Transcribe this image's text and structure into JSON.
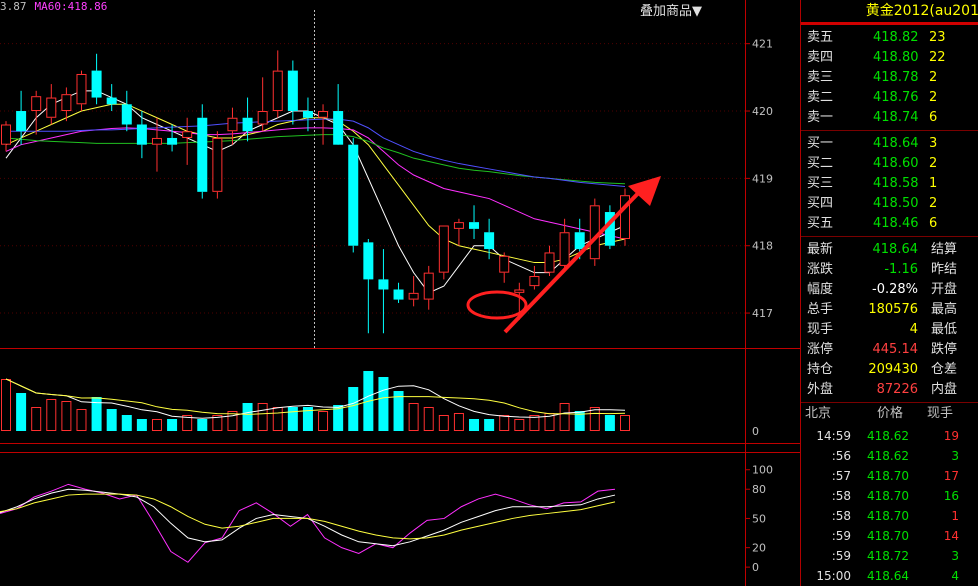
{
  "header": {
    "ma_prefix": "3.87",
    "ma60": "MA60:418.86",
    "overlay_button": "叠加商品▼"
  },
  "symbol": {
    "name": "黄金2012",
    "code": "(au201"
  },
  "colors": {
    "up": "#ff3030",
    "down": "#00ffff",
    "ma_white": "#ffffff",
    "ma_yellow": "#ffff40",
    "ma_magenta": "#ff30ff",
    "ma_green": "#20c020",
    "ma_blue": "#5050ff",
    "arrow": "#ff2020"
  },
  "order_book": {
    "asks": [
      {
        "label": "卖五",
        "price": "418.82",
        "volume": "23"
      },
      {
        "label": "卖四",
        "price": "418.80",
        "volume": "22"
      },
      {
        "label": "卖三",
        "price": "418.78",
        "volume": "2"
      },
      {
        "label": "卖二",
        "price": "418.76",
        "volume": "2"
      },
      {
        "label": "卖一",
        "price": "418.74",
        "volume": "6"
      }
    ],
    "bids": [
      {
        "label": "买一",
        "price": "418.64",
        "volume": "3"
      },
      {
        "label": "买二",
        "price": "418.60",
        "volume": "2"
      },
      {
        "label": "买三",
        "price": "418.58",
        "volume": "1"
      },
      {
        "label": "买四",
        "price": "418.50",
        "volume": "2"
      },
      {
        "label": "买五",
        "price": "418.46",
        "volume": "6"
      }
    ]
  },
  "quote": [
    {
      "label": "最新",
      "value": "418.64",
      "label2": "结算",
      "color": "#00e000"
    },
    {
      "label": "涨跌",
      "value": "-1.16",
      "label2": "昨结",
      "color": "#00e000"
    },
    {
      "label": "幅度",
      "value": "-0.28%",
      "label2": "开盘",
      "color": "#ffffff"
    },
    {
      "label": "总手",
      "value": "180576",
      "label2": "最高",
      "color": "#ffff00"
    },
    {
      "label": "现手",
      "value": "4",
      "label2": "最低",
      "color": "#ffff00"
    },
    {
      "label": "涨停",
      "value": "445.14",
      "label2": "跌停",
      "color": "#ff4040"
    },
    {
      "label": "持仓",
      "value": "209430",
      "label2": "仓差",
      "color": "#ffff00"
    },
    {
      "label": "外盘",
      "value": "87226",
      "label2": "内盘",
      "color": "#ff4040"
    }
  ],
  "ticks_header": {
    "place": "北京",
    "price": "价格",
    "qty": "现手"
  },
  "ticks": [
    {
      "time": "14:59",
      "price": "418.62",
      "qty": "19",
      "qcolor": "#ff3030"
    },
    {
      "time": ":56",
      "price": "418.62",
      "qty": "3",
      "qcolor": "#00e000"
    },
    {
      "time": ":57",
      "price": "418.70",
      "qty": "17",
      "qcolor": "#ff3030"
    },
    {
      "time": ":58",
      "price": "418.70",
      "qty": "16",
      "qcolor": "#00e000"
    },
    {
      "time": ":58",
      "price": "418.70",
      "qty": "1",
      "qcolor": "#ff3030"
    },
    {
      "time": ":59",
      "price": "418.70",
      "qty": "14",
      "qcolor": "#ff3030"
    },
    {
      "time": ":59",
      "price": "418.72",
      "qty": "3",
      "qcolor": "#00e000"
    },
    {
      "time": "15:00",
      "price": "418.64",
      "qty": "4",
      "qcolor": "#00e000"
    }
  ],
  "chart_data": {
    "type": "candlestick",
    "price_axis": {
      "ylim": [
        416.6,
        421.5
      ],
      "ticks": [
        "421",
        "420",
        "419",
        "418",
        "417"
      ]
    },
    "volume_axis": {
      "ticks": [
        "0"
      ]
    },
    "oscillator_axis": {
      "ylim": [
        -5,
        110
      ],
      "ticks": [
        "100",
        "80",
        "50",
        "20",
        "0"
      ]
    },
    "candles": [
      {
        "o": 419.5,
        "h": 419.85,
        "l": 419.4,
        "c": 419.8
      },
      {
        "o": 420.0,
        "h": 420.3,
        "l": 419.5,
        "c": 419.7
      },
      {
        "o": 420.0,
        "h": 420.3,
        "l": 419.65,
        "c": 420.22
      },
      {
        "o": 419.9,
        "h": 420.4,
        "l": 419.8,
        "c": 420.2
      },
      {
        "o": 420.0,
        "h": 420.35,
        "l": 419.85,
        "c": 420.25
      },
      {
        "o": 420.1,
        "h": 420.6,
        "l": 420.0,
        "c": 420.55
      },
      {
        "o": 420.6,
        "h": 420.85,
        "l": 420.1,
        "c": 420.2
      },
      {
        "o": 420.2,
        "h": 420.4,
        "l": 420.0,
        "c": 420.1
      },
      {
        "o": 420.1,
        "h": 420.3,
        "l": 419.7,
        "c": 419.8
      },
      {
        "o": 419.8,
        "h": 420.0,
        "l": 419.3,
        "c": 419.5
      },
      {
        "o": 419.5,
        "h": 419.9,
        "l": 419.1,
        "c": 419.6
      },
      {
        "o": 419.6,
        "h": 419.8,
        "l": 419.4,
        "c": 419.5
      },
      {
        "o": 419.6,
        "h": 419.9,
        "l": 419.2,
        "c": 419.7
      },
      {
        "o": 419.9,
        "h": 420.1,
        "l": 418.7,
        "c": 418.8
      },
      {
        "o": 418.8,
        "h": 419.7,
        "l": 418.7,
        "c": 419.6
      },
      {
        "o": 419.7,
        "h": 420.05,
        "l": 419.5,
        "c": 419.9
      },
      {
        "o": 419.9,
        "h": 420.2,
        "l": 419.55,
        "c": 419.7
      },
      {
        "o": 419.8,
        "h": 420.5,
        "l": 419.7,
        "c": 420.0
      },
      {
        "o": 420.0,
        "h": 420.9,
        "l": 419.9,
        "c": 420.6
      },
      {
        "o": 420.6,
        "h": 420.75,
        "l": 419.8,
        "c": 420.0
      },
      {
        "o": 420.0,
        "h": 420.2,
        "l": 419.7,
        "c": 419.9
      },
      {
        "o": 419.9,
        "h": 420.1,
        "l": 419.5,
        "c": 420.0
      },
      {
        "o": 420.0,
        "h": 420.4,
        "l": 419.7,
        "c": 419.5
      },
      {
        "o": 419.5,
        "h": 419.6,
        "l": 417.9,
        "c": 418.0
      },
      {
        "o": 418.05,
        "h": 418.1,
        "l": 416.7,
        "c": 417.5
      },
      {
        "o": 417.5,
        "h": 417.95,
        "l": 416.7,
        "c": 417.35
      },
      {
        "o": 417.35,
        "h": 417.45,
        "l": 417.15,
        "c": 417.2
      },
      {
        "o": 417.2,
        "h": 417.55,
        "l": 417.1,
        "c": 417.3
      },
      {
        "o": 417.2,
        "h": 417.7,
        "l": 417.05,
        "c": 417.6
      },
      {
        "o": 417.6,
        "h": 418.3,
        "l": 417.5,
        "c": 418.3
      },
      {
        "o": 418.25,
        "h": 418.4,
        "l": 418.0,
        "c": 418.35
      },
      {
        "o": 418.35,
        "h": 418.6,
        "l": 418.1,
        "c": 418.25
      },
      {
        "o": 418.2,
        "h": 418.4,
        "l": 417.8,
        "c": 417.95
      },
      {
        "o": 417.6,
        "h": 417.9,
        "l": 417.45,
        "c": 417.85
      },
      {
        "o": 417.3,
        "h": 417.45,
        "l": 416.9,
        "c": 417.35
      },
      {
        "o": 417.4,
        "h": 417.7,
        "l": 417.35,
        "c": 417.55
      },
      {
        "o": 417.6,
        "h": 418.0,
        "l": 417.55,
        "c": 417.9
      },
      {
        "o": 417.7,
        "h": 418.4,
        "l": 417.65,
        "c": 418.2
      },
      {
        "o": 418.2,
        "h": 418.4,
        "l": 417.8,
        "c": 417.95
      },
      {
        "o": 417.8,
        "h": 418.7,
        "l": 417.7,
        "c": 418.6
      },
      {
        "o": 418.5,
        "h": 418.6,
        "l": 417.95,
        "c": 418.0
      },
      {
        "o": 418.1,
        "h": 418.85,
        "l": 418.0,
        "c": 418.75
      }
    ],
    "ma_series": [
      {
        "color": "#ffffff",
        "values": [
          419.3,
          419.6,
          419.9,
          420.1,
          420.2,
          420.3,
          420.3,
          420.2,
          420.1,
          419.9,
          419.8,
          419.7,
          419.6,
          419.5,
          419.4,
          419.5,
          419.7,
          419.8,
          419.9,
          420.0,
          420.0,
          419.9,
          419.8,
          419.5,
          419.0,
          418.5,
          418.0,
          417.6,
          417.3,
          417.4,
          417.7,
          418.0,
          418.0,
          417.8,
          417.7,
          417.6,
          417.6,
          417.8,
          418.0,
          418.1,
          418.2,
          418.3
        ]
      },
      {
        "color": "#ffff40",
        "values": [
          419.5,
          419.6,
          419.7,
          419.8,
          419.9,
          420.0,
          420.05,
          420.1,
          420.1,
          420.0,
          419.9,
          419.8,
          419.7,
          419.65,
          419.6,
          419.6,
          419.65,
          419.7,
          419.8,
          419.85,
          419.9,
          419.9,
          419.85,
          419.7,
          419.5,
          419.2,
          418.9,
          418.6,
          418.3,
          418.1,
          418.0,
          417.95,
          417.9,
          417.85,
          417.8,
          417.75,
          417.75,
          417.8,
          417.9,
          418.0,
          418.05,
          418.1
        ]
      },
      {
        "color": "#ff30ff",
        "values": [
          419.4,
          419.5,
          419.55,
          419.6,
          419.65,
          419.7,
          419.72,
          419.74,
          419.75,
          419.74,
          419.72,
          419.7,
          419.68,
          419.65,
          419.65,
          419.66,
          419.68,
          419.7,
          419.72,
          419.74,
          419.75,
          419.75,
          419.74,
          419.72,
          419.6,
          419.4,
          419.2,
          419.05,
          418.95,
          418.85,
          418.8,
          418.75,
          418.7,
          418.6,
          418.5,
          418.4,
          418.35,
          418.3,
          418.25,
          418.2,
          418.15,
          418.1
        ]
      },
      {
        "color": "#20c020",
        "values": [
          419.6,
          419.58,
          419.56,
          419.55,
          419.54,
          419.53,
          419.52,
          419.52,
          419.52,
          419.52,
          419.52,
          419.52,
          419.53,
          419.54,
          419.55,
          419.56,
          419.58,
          419.6,
          419.62,
          419.63,
          419.64,
          419.65,
          419.65,
          419.62,
          419.55,
          419.45,
          419.38,
          419.3,
          419.25,
          419.2,
          419.15,
          419.12,
          419.1,
          419.07,
          419.04,
          419.02,
          419.0,
          418.98,
          418.96,
          418.94,
          418.93,
          418.92
        ]
      },
      {
        "color": "#5050ff",
        "values": [
          419.7,
          419.7,
          419.7,
          419.7,
          419.7,
          419.71,
          419.72,
          419.72,
          419.73,
          419.74,
          419.75,
          419.76,
          419.77,
          419.78,
          419.8,
          419.82,
          419.83,
          419.84,
          419.85,
          419.86,
          419.87,
          419.88,
          419.88,
          419.85,
          419.75,
          419.6,
          419.5,
          419.4,
          419.33,
          419.27,
          419.22,
          419.18,
          419.14,
          419.1,
          419.06,
          419.02,
          419.0,
          418.97,
          418.94,
          418.92,
          418.9,
          418.88
        ]
      }
    ],
    "volumes": [
      26,
      19,
      12,
      16,
      15,
      11,
      17,
      11,
      8,
      6,
      6,
      6,
      8,
      6,
      8,
      10,
      14,
      14,
      12,
      12,
      12,
      10,
      13,
      22,
      30,
      27,
      20,
      14,
      12,
      8,
      9,
      6,
      6,
      8,
      6,
      8,
      9,
      14,
      10,
      12,
      8,
      8
    ],
    "osc_lines": [
      {
        "color": "#ff30ff",
        "values": [
          55,
          60,
          72,
          78,
          85,
          80,
          76,
          70,
          74,
          46,
          16,
          5,
          25,
          30,
          58,
          66,
          55,
          42,
          54,
          30,
          20,
          14,
          24,
          20,
          35,
          48,
          50,
          62,
          70,
          75,
          70,
          64,
          60,
          66,
          67,
          78,
          80
        ]
      },
      {
        "color": "#ffffff",
        "values": [
          56,
          62,
          70,
          76,
          80,
          79,
          77,
          75,
          72,
          62,
          45,
          30,
          26,
          28,
          40,
          50,
          54,
          52,
          50,
          42,
          33,
          26,
          24,
          22,
          26,
          32,
          38,
          46,
          52,
          58,
          62,
          62,
          62,
          63,
          64,
          70,
          74
        ]
      },
      {
        "color": "#ffff40",
        "values": [
          57,
          60,
          66,
          70,
          74,
          75,
          75,
          75,
          74,
          70,
          62,
          52,
          44,
          40,
          42,
          46,
          50,
          50,
          50,
          47,
          42,
          37,
          33,
          30,
          29,
          30,
          33,
          38,
          42,
          46,
          50,
          53,
          55,
          57,
          59,
          63,
          67
        ]
      }
    ]
  }
}
